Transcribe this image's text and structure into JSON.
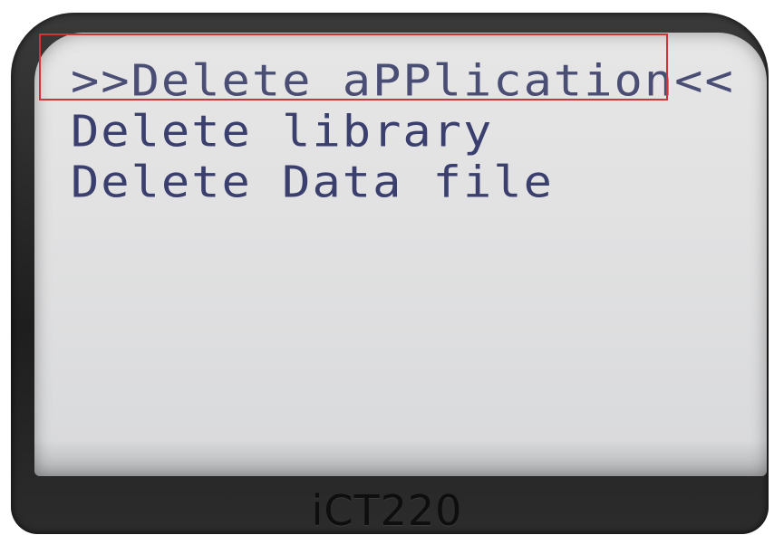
{
  "device": {
    "model_label": "iCT220"
  },
  "menu": {
    "items": [
      {
        "label": ">>Delete aPPlication<<",
        "selected": true
      },
      {
        "label": "Delete library",
        "selected": false
      },
      {
        "label": "Delete Data file",
        "selected": false
      }
    ]
  },
  "colors": {
    "screen": "#e1e1e2",
    "text": "#3a3f6e",
    "highlight": "#d2323a",
    "bezel": "#1e1e1e"
  }
}
